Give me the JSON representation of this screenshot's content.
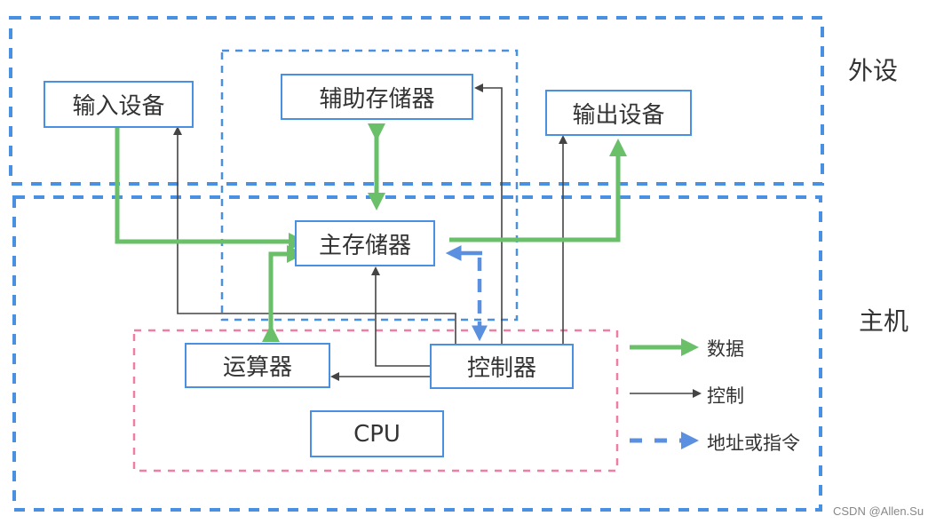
{
  "diagram": {
    "regions": {
      "peripheral_label": "外设",
      "host_label": "主机"
    },
    "components": {
      "input_device": "输入设备",
      "auxiliary_memory": "辅助存储器",
      "output_device": "输出设备",
      "main_memory": "主存储器",
      "alu": "运算器",
      "control_unit": "控制器",
      "cpu": "CPU"
    },
    "legend": [
      {
        "key": "data",
        "label": "数据",
        "style": "thick-green-arrow",
        "color": "#6abf69"
      },
      {
        "key": "control",
        "label": "控制",
        "style": "thin-dark-arrow",
        "color": "#444444"
      },
      {
        "key": "address",
        "label": "地址或指令",
        "style": "dashed-blue-arrow",
        "color": "#5b8fe0"
      }
    ],
    "colors": {
      "region_border": "#4a90e2",
      "cpu_border": "#ef7fa0",
      "data": "#6abf69",
      "control": "#444444",
      "address": "#5b8fe0"
    },
    "watermark": "CSDN @Allen.Su"
  }
}
